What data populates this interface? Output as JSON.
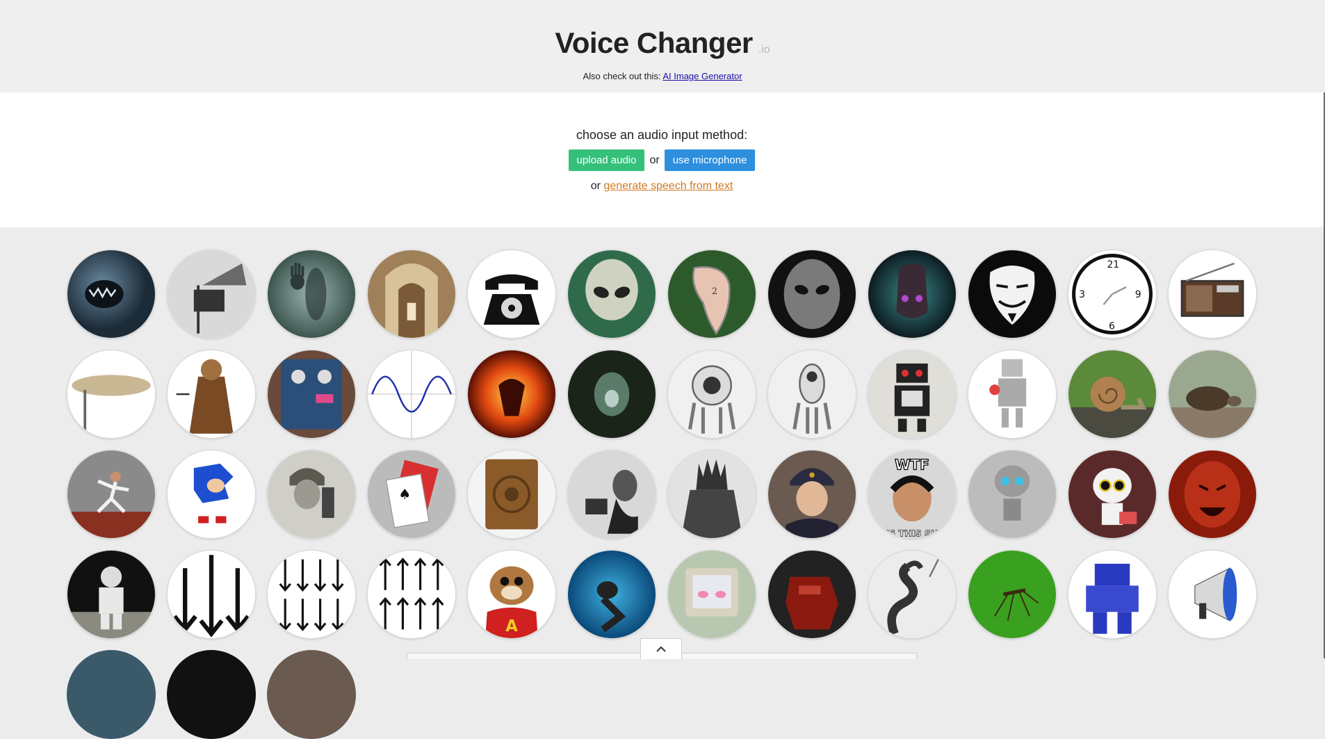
{
  "header": {
    "title": "Voice Changer",
    "tld": ".io",
    "also_prefix": "Also check out this:",
    "also_link": "AI Image Generator"
  },
  "input": {
    "prompt": "choose an audio input method:",
    "upload_label": "upload audio",
    "or_label": "or",
    "mic_label": "use microphone",
    "gen_prefix": "or",
    "gen_link": "generate speech from text"
  },
  "colors": {
    "upload": "#35c07a",
    "microphone": "#2d8fde",
    "gen_link": "#d0771f",
    "header_bg": "#efefef",
    "panel_bg": "#ffffff",
    "page_bg": "#ececec"
  },
  "effects": [
    {
      "name": "monster-roar-icon"
    },
    {
      "name": "gramophone-icon"
    },
    {
      "name": "ghost-hand-icon"
    },
    {
      "name": "cathedral-icon"
    },
    {
      "name": "telephone-icon"
    },
    {
      "name": "alien-icon"
    },
    {
      "name": "melting-clock-icon"
    },
    {
      "name": "grey-alien-icon"
    },
    {
      "name": "cyborg-head-icon"
    },
    {
      "name": "anonymous-mask-icon"
    },
    {
      "name": "reversed-clock-icon"
    },
    {
      "name": "radio-icon"
    },
    {
      "name": "cymbal-icon"
    },
    {
      "name": "dalek-icon"
    },
    {
      "name": "guitar-pedal-icon"
    },
    {
      "name": "sine-wave-icon"
    },
    {
      "name": "fire-demon-icon"
    },
    {
      "name": "cave-icon"
    },
    {
      "name": "white-robot-icon"
    },
    {
      "name": "white-robot-2-icon"
    },
    {
      "name": "tv-robot-icon"
    },
    {
      "name": "toy-robot-icon"
    },
    {
      "name": "snail-icon"
    },
    {
      "name": "turtle-icon"
    },
    {
      "name": "sprinter-icon"
    },
    {
      "name": "sonic-icon"
    },
    {
      "name": "radio-soldier-icon"
    },
    {
      "name": "playing-cards-icon"
    },
    {
      "name": "wooden-speaker-icon"
    },
    {
      "name": "phonograph-man-icon"
    },
    {
      "name": "dark-knight-icon"
    },
    {
      "name": "russian-man-icon"
    },
    {
      "name": "wtf-meme-icon"
    },
    {
      "name": "gir-robot-icon"
    },
    {
      "name": "kirobo-robot-icon"
    },
    {
      "name": "red-devil-icon"
    },
    {
      "name": "astronaut-icon"
    },
    {
      "name": "big-arrows-down-icon"
    },
    {
      "name": "small-arrows-down-icon"
    },
    {
      "name": "arrows-up-icon"
    },
    {
      "name": "chipmunk-icon"
    },
    {
      "name": "diver-icon"
    },
    {
      "name": "retro-computer-icon"
    },
    {
      "name": "red-robot-icon"
    },
    {
      "name": "cobra-robot-icon"
    },
    {
      "name": "mosquito-icon"
    },
    {
      "name": "blue-mech-icon"
    },
    {
      "name": "megaphone-icon"
    }
  ],
  "text_overlays": {
    "wtf_top": "WTF",
    "wtf_bottom": "IS THIS SH",
    "chipmunk_letter": "A"
  }
}
